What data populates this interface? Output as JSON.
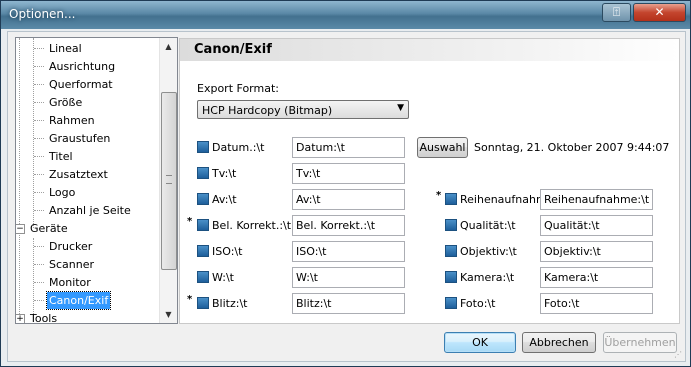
{
  "window": {
    "title": "Optionen..."
  },
  "tree": {
    "items": [
      {
        "label": "Lineal",
        "level": 2
      },
      {
        "label": "Ausrichtung",
        "level": 2
      },
      {
        "label": "Querformat",
        "level": 2
      },
      {
        "label": "Größe",
        "level": 2
      },
      {
        "label": "Rahmen",
        "level": 2
      },
      {
        "label": "Graustufen",
        "level": 2
      },
      {
        "label": "Titel",
        "level": 2
      },
      {
        "label": "Zusatztext",
        "level": 2
      },
      {
        "label": "Logo",
        "level": 2
      },
      {
        "label": "Anzahl je Seite",
        "level": 2
      },
      {
        "label": "Geräte",
        "level": 1,
        "expander": "−"
      },
      {
        "label": "Drucker",
        "level": 2
      },
      {
        "label": "Scanner",
        "level": 2
      },
      {
        "label": "Monitor",
        "level": 2
      },
      {
        "label": "Canon/Exif",
        "level": 2,
        "selected": true
      },
      {
        "label": "Tools",
        "level": 1,
        "expander": "+"
      }
    ]
  },
  "panel": {
    "title": "Canon/Exif",
    "export_format_label": "Export Format:",
    "export_format_value": "HCP  Hardcopy (Bitmap)",
    "auswahl_label": "Auswahl",
    "datetime_text": "Sonntag, 21. Oktober 2007  9:44:07",
    "left_fields": [
      {
        "label": "Datum.:\\t",
        "value": "Datum:\\t",
        "star": false,
        "checked": true
      },
      {
        "label": "Tv:\\t",
        "value": "Tv:\\t",
        "star": false,
        "checked": true
      },
      {
        "label": "Av:\\t",
        "value": "Av:\\t",
        "star": false,
        "checked": true
      },
      {
        "label": "Bel. Korrekt.:\\t",
        "value": "Bel. Korrekt.:\\t",
        "star": true,
        "checked": true
      },
      {
        "label": "ISO:\\t",
        "value": "ISO:\\t",
        "star": false,
        "checked": true
      },
      {
        "label": "W:\\t",
        "value": "W:\\t",
        "star": false,
        "checked": true
      },
      {
        "label": "Blitz:\\t",
        "value": "Blitz:\\t",
        "star": true,
        "checked": true
      }
    ],
    "right_fields": [
      {
        "label": "Reihenaufnahm",
        "value": "Reihenaufnahme:\\t",
        "star": true,
        "checked": true
      },
      {
        "label": "Qualität:\\t",
        "value": "Qualität:\\t",
        "star": false,
        "checked": true
      },
      {
        "label": "Objektiv:\\t",
        "value": "Objektiv:\\t",
        "star": false,
        "checked": true
      },
      {
        "label": "Kamera:\\t",
        "value": "Kamera:\\t",
        "star": false,
        "checked": true
      },
      {
        "label": "Foto:\\t",
        "value": "Foto:\\t",
        "star": false,
        "checked": true
      }
    ]
  },
  "buttons": {
    "ok": "OK",
    "cancel": "Abbrechen",
    "apply": "Übernehmen"
  }
}
